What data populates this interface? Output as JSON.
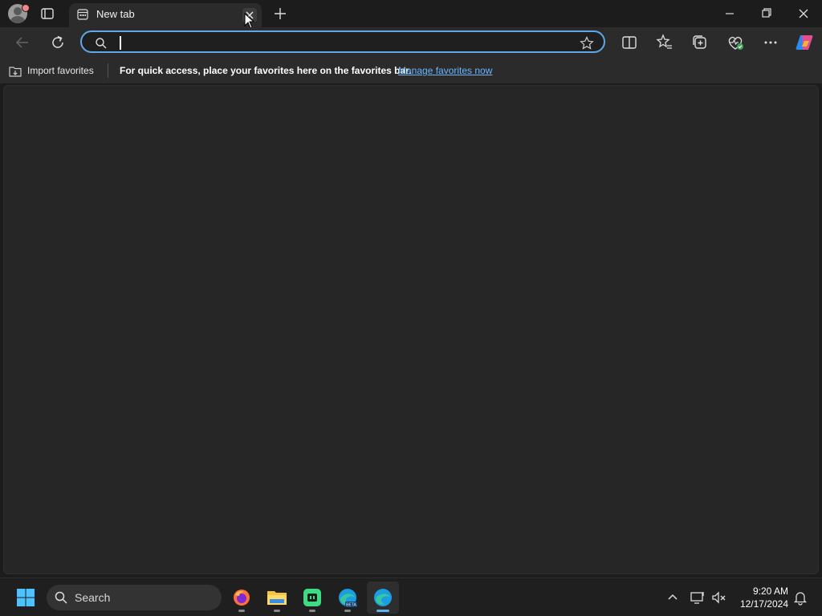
{
  "tab": {
    "title": "New tab"
  },
  "address_bar": {
    "value": "",
    "placeholder": ""
  },
  "favorites_bar": {
    "import_label": "Import favorites",
    "message": "For quick access, place your favorites here on the favorites bar.",
    "manage_link": "Manage favorites now"
  },
  "taskbar": {
    "search_label": "Search",
    "apps": [
      "firefox",
      "file-explorer",
      "app",
      "edge-beta",
      "edge"
    ],
    "clock": {
      "time": "9:20 AM",
      "date": "12/17/2024"
    }
  },
  "colors": {
    "accent": "#5fa8e8",
    "link": "#6cb6ff"
  }
}
